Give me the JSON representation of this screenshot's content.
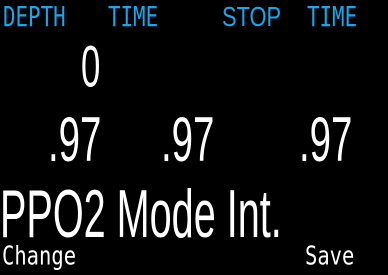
{
  "header": {
    "depth_label": "DEPTH",
    "time_label": "TIME",
    "stop_label": "STOP",
    "stop_time_label": "TIME",
    "color": "#1aa6ea"
  },
  "main": {
    "depth_value": "0",
    "ppo2_values": [
      ".97",
      ".97",
      ".97"
    ],
    "mode_text": "PPO2 Mode Int."
  },
  "softkeys": {
    "left_label": "Change",
    "right_label": "Save"
  },
  "colors": {
    "background": "#000000",
    "text": "#ffffff",
    "header": "#1aa6ea"
  }
}
